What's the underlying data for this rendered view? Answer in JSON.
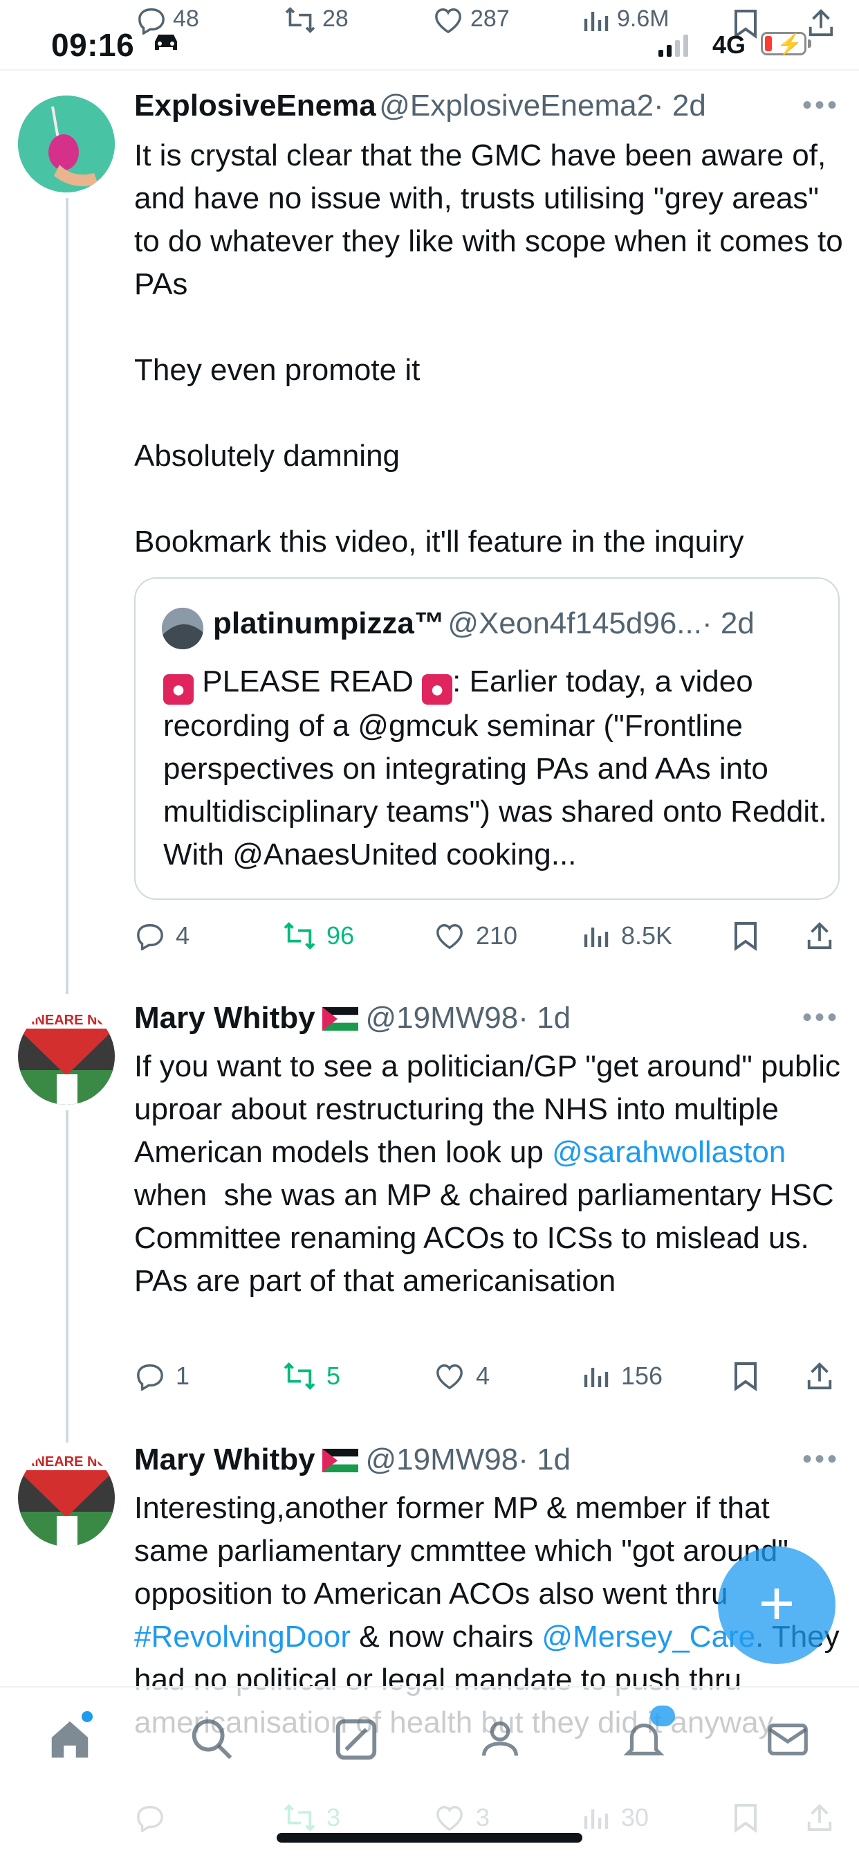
{
  "status_bar": {
    "time": "09:16",
    "network": "4G"
  },
  "prev_tweet_actions": {
    "replies": "48",
    "reposts": "28",
    "likes": "287",
    "views": "9.6M"
  },
  "tweets": [
    {
      "name": "ExplosiveEnema",
      "handle": "@ExplosiveEnema2",
      "time": "· 2d",
      "text": "It is crystal clear that the GMC have been aware of, and have no issue with, trusts utilising \"grey areas\" to do whatever they like with scope when it comes to PAs\n\nThey even promote it\n\nAbsolutely damning\n\nBookmark this video, it'll feature in the inquiry",
      "quote": {
        "name": "platinumpizza™",
        "handle": "@Xeon4f145d96...",
        "time": "· 2d",
        "text_a": "PLEASE READ",
        "text_b": ": Earlier today, a video recording of a @gmcuk seminar (\"Frontline perspectives on integrating PAs and AAs into multidisciplinary teams\") was shared onto Reddit. With @AnaesUnited cooking..."
      },
      "actions": {
        "replies": "4",
        "reposts": "96",
        "likes": "210",
        "views": "8.5K"
      }
    },
    {
      "name": "Mary Whitby",
      "handle": "@19MW98",
      "time": "· 1d",
      "text_a": "If you want to see a politician/GP \"get around\" public uproar about restructuring the NHS into multiple American models then look up ",
      "link": "@sarahwollaston",
      "text_b": " when  she was an MP & chaired parliamentary HSC Committee renaming ACOs to ICSs to mislead us. PAs are part of that americanisation",
      "actions": {
        "replies": "1",
        "reposts": "5",
        "likes": "4",
        "views": "156"
      }
    },
    {
      "name": "Mary Whitby",
      "handle": "@19MW98",
      "time": "· 1d",
      "text_a": "Interesting,another former MP & member if that same parliamentary cmmttee which \"got around\" opposition to American ACOs also went thru ",
      "link_a": "#RevolvingDoor",
      "text_b": " & now chairs ",
      "link_b": "@Mersey_Care",
      "text_c": ". They had no political or legal mandate to push thru americanisation of health but they did it anyway",
      "actions": {
        "replies": "",
        "reposts": "3",
        "likes": "3",
        "views": "30"
      }
    }
  ],
  "avatar_text": "ANEARE NO",
  "icons": [
    "reply-icon",
    "repost-icon",
    "like-icon",
    "views-icon",
    "bookmark-icon",
    "share-icon",
    "home-icon",
    "search-icon",
    "grok-icon",
    "communities-icon",
    "notifications-icon",
    "messages-icon",
    "compose-icon"
  ]
}
